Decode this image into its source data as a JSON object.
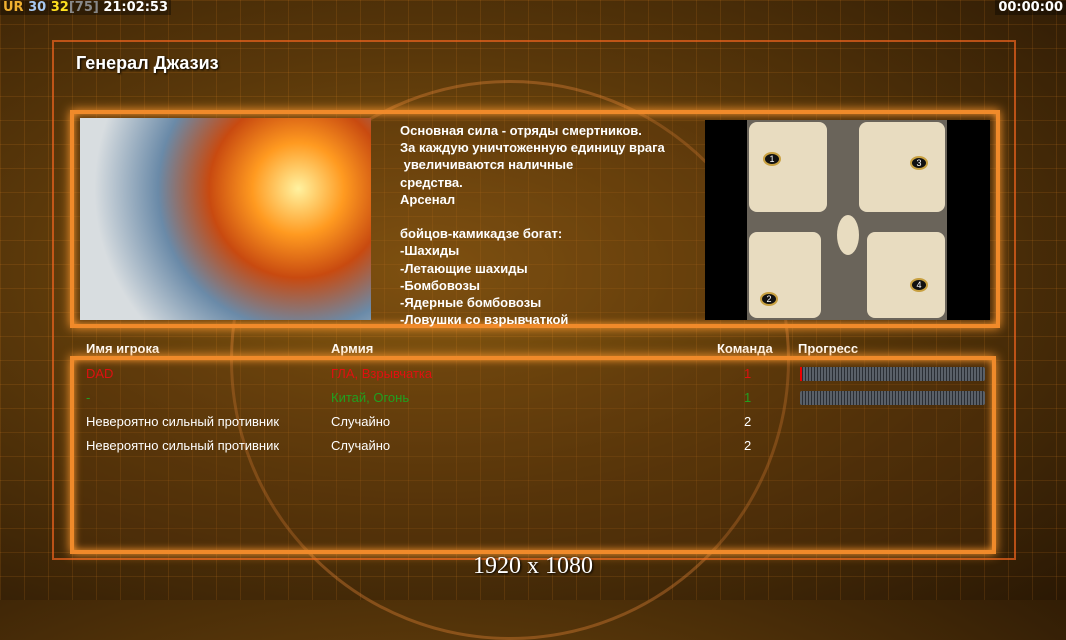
{
  "hud": {
    "ur": "UR",
    "fps": "30",
    "fps2": "32",
    "limit": "[75]",
    "clock": "21:02:53",
    "timer": "00:00:00"
  },
  "title": "Генерал Джазиз",
  "description": "Основная сила - отряды смертников.\nЗа каждую уничтоженную единицу врага\n увеличиваются наличные\nсредства.\nАрсенал\n\nбойцов-камикадзе богат:\n-Шахиды\n-Летающие шахиды\n-Бомбовозы\n-Ядерные бомбовозы\n-Ловушки со взрывчаткой",
  "map": {
    "starts": [
      "1",
      "2",
      "3",
      "4"
    ]
  },
  "table": {
    "headers": {
      "name": "Имя игрока",
      "army": "Армия",
      "team": "Команда",
      "progress": "Прогресс"
    },
    "rows": [
      {
        "name": "DAD",
        "army": "ГЛА, Взрывчатка",
        "team": "1",
        "color": "#e01010",
        "progress": 1
      },
      {
        "name": "-",
        "army": "Китай, Огонь",
        "team": "1",
        "color": "#20a020",
        "progress": 0
      },
      {
        "name": "Невероятно сильный противник",
        "army": "Случайно",
        "team": "2",
        "color": "#ffffff"
      },
      {
        "name": "Невероятно сильный противник",
        "army": "Случайно",
        "team": "2",
        "color": "#ffffff"
      }
    ]
  },
  "resolution": "1920 x 1080"
}
